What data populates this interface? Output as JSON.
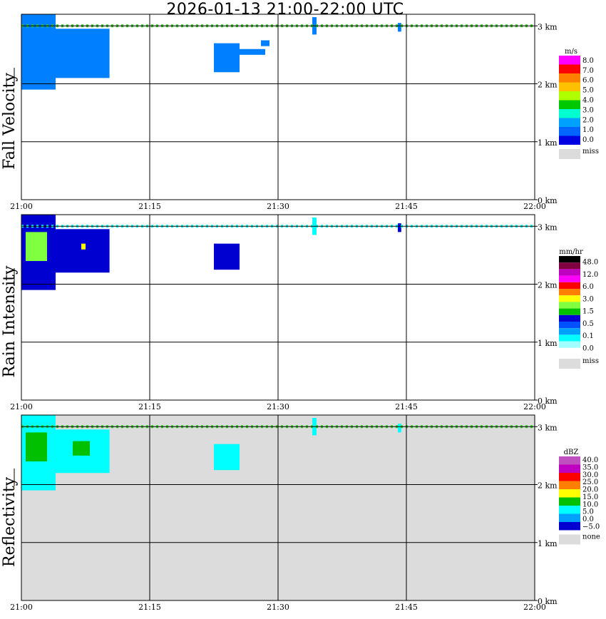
{
  "title": "2026-01-13   21:00-22:00 UTC",
  "chart_data": [
    {
      "type": "heatmap",
      "ylabel": "Fall Velocity",
      "xticks": [
        "21:00",
        "21:15",
        "21:30",
        "21:45",
        "22:00"
      ],
      "yticks": [
        "0 km",
        "1 km",
        "2 km",
        "3 km"
      ],
      "ylim": [
        0,
        3.2
      ],
      "xlim": [
        "21:00",
        "22:00"
      ],
      "grid": true,
      "background": "#ffffff",
      "legend": {
        "unit": "m/s",
        "labels": [
          "8.0",
          "7.0",
          "6.0",
          "5.0",
          "4.0",
          "3.0",
          "2.0",
          "1.0",
          "0.0"
        ],
        "colors": [
          "#ff00ff",
          "#ff0000",
          "#ff8000",
          "#ffc000",
          "#b0ff00",
          "#00c800",
          "#00ffd0",
          "#00a0ff",
          "#0064ff",
          "#0000e0"
        ],
        "miss_label": "miss",
        "miss_color": "#dcdcdc"
      },
      "echoes": [
        {
          "t0": 0.0,
          "t1": 10.3,
          "z0": 2.1,
          "z1": 2.95,
          "value": "1.5",
          "color": "#0080ff"
        },
        {
          "t0": 0.0,
          "t1": 4.0,
          "z0": 1.9,
          "z1": 3.2,
          "value": "1.5",
          "color": "#0080ff"
        },
        {
          "t0": 22.5,
          "t1": 25.5,
          "z0": 2.2,
          "z1": 2.7,
          "value": "1.5",
          "color": "#0080ff"
        },
        {
          "t0": 25.5,
          "t1": 28.5,
          "z0": 2.5,
          "z1": 2.6,
          "value": "1.5",
          "color": "#0080ff"
        },
        {
          "t0": 28.0,
          "t1": 29.0,
          "z0": 2.65,
          "z1": 2.75,
          "value": "1.5",
          "color": "#0080ff"
        },
        {
          "t0": 34.0,
          "t1": 34.5,
          "z0": 2.85,
          "z1": 3.15,
          "value": "1.5",
          "color": "#0080ff"
        },
        {
          "t0": 44.0,
          "t1": 44.4,
          "z0": 2.9,
          "z1": 3.05,
          "value": "1.5",
          "color": "#0080ff"
        }
      ],
      "bright_band_km": 3.0
    },
    {
      "type": "heatmap",
      "ylabel": "Rain Intensity",
      "xticks": [
        "21:00",
        "21:15",
        "21:30",
        "21:45",
        "22:00"
      ],
      "yticks": [
        "0 km",
        "1 km",
        "2 km",
        "3 km"
      ],
      "ylim": [
        0,
        3.2
      ],
      "xlim": [
        "21:00",
        "22:00"
      ],
      "grid": true,
      "background": "#ffffff",
      "legend": {
        "unit": "mm/hr",
        "labels": [
          "48.0",
          "12.0",
          "6.0",
          "3.0",
          "1.5",
          "0.5",
          "0.1",
          "0.0"
        ],
        "colors": [
          "#000000",
          "#800040",
          "#c000c0",
          "#ff00ff",
          "#ff0000",
          "#ff8000",
          "#ffff00",
          "#80ff40",
          "#00c000",
          "#0000d0",
          "#0050ff",
          "#00a0ff",
          "#00ffff",
          "#a0ffff",
          "#ffffff"
        ],
        "miss_label": "miss",
        "miss_color": "#dcdcdc"
      },
      "echoes": [
        {
          "t0": 0.0,
          "t1": 10.3,
          "z0": 2.2,
          "z1": 2.95,
          "value": "0.5",
          "color": "#0000d0"
        },
        {
          "t0": 0.0,
          "t1": 4.0,
          "z0": 1.9,
          "z1": 3.2,
          "value": "0.5",
          "color": "#0000d0"
        },
        {
          "t0": 0.5,
          "t1": 3.0,
          "z0": 2.4,
          "z1": 2.9,
          "value": "1.5",
          "color": "#80ff40"
        },
        {
          "t0": 7.0,
          "t1": 7.5,
          "z0": 2.6,
          "z1": 2.7,
          "value": "3.0",
          "color": "#ffff00"
        },
        {
          "t0": 22.5,
          "t1": 25.5,
          "z0": 2.25,
          "z1": 2.7,
          "value": "0.5",
          "color": "#0000d0"
        },
        {
          "t0": 34.0,
          "t1": 34.5,
          "z0": 2.85,
          "z1": 3.15,
          "value": "0.1",
          "color": "#00ffff"
        },
        {
          "t0": 44.0,
          "t1": 44.4,
          "z0": 2.9,
          "z1": 3.05,
          "value": "0.5",
          "color": "#0000d0"
        }
      ],
      "bright_band_km": 3.0
    },
    {
      "type": "heatmap",
      "ylabel": "Reflectivity",
      "xticks": [
        "21:00",
        "21:15",
        "21:30",
        "21:45",
        "22:00"
      ],
      "yticks": [
        "0 km",
        "1 km",
        "2 km",
        "3 km"
      ],
      "ylim": [
        0,
        3.2
      ],
      "xlim": [
        "21:00",
        "22:00"
      ],
      "grid": true,
      "background": "#dcdcdc",
      "legend": {
        "unit": "dBZ",
        "labels": [
          "40.0",
          "35.0",
          "30.0",
          "25.0",
          "20.0",
          "15.0",
          "10.0",
          "5.0",
          "0.0",
          "−5.0"
        ],
        "colors": [
          "#c050c0",
          "#c000c0",
          "#ff0000",
          "#ff8000",
          "#ffff00",
          "#00c000",
          "#00ffff",
          "#00a0ff",
          "#0000d0"
        ],
        "miss_label": "none",
        "miss_color": "#dcdcdc"
      },
      "echoes": [
        {
          "t0": 0.0,
          "t1": 10.3,
          "z0": 2.2,
          "z1": 2.95,
          "value": "10.0",
          "color": "#00ffff"
        },
        {
          "t0": 0.0,
          "t1": 4.0,
          "z0": 1.9,
          "z1": 3.2,
          "value": "10.0",
          "color": "#00ffff"
        },
        {
          "t0": 0.5,
          "t1": 3.0,
          "z0": 2.4,
          "z1": 2.9,
          "value": "15.0",
          "color": "#00c000"
        },
        {
          "t0": 6.0,
          "t1": 8.0,
          "z0": 2.5,
          "z1": 2.75,
          "value": "15.0",
          "color": "#00c000"
        },
        {
          "t0": 22.5,
          "t1": 25.5,
          "z0": 2.25,
          "z1": 2.7,
          "value": "10.0",
          "color": "#00ffff"
        },
        {
          "t0": 34.0,
          "t1": 34.5,
          "z0": 2.85,
          "z1": 3.15,
          "value": "10.0",
          "color": "#00ffff"
        },
        {
          "t0": 44.0,
          "t1": 44.4,
          "z0": 2.9,
          "z1": 3.05,
          "value": "10.0",
          "color": "#00ffff"
        }
      ],
      "bright_band_km": 3.0
    }
  ]
}
